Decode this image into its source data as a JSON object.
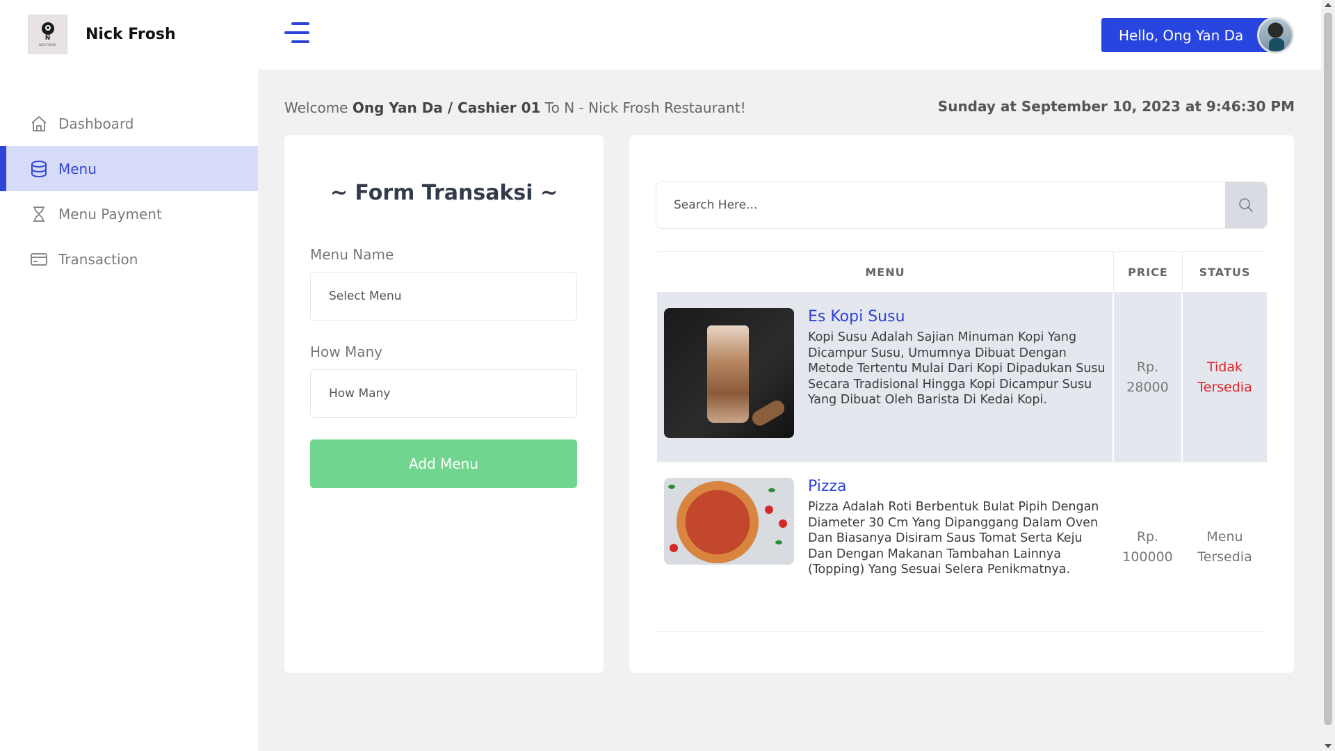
{
  "brand": {
    "name": "Nick Frosh",
    "logo_letter": "N",
    "logo_tagline": "NICK FROSH"
  },
  "sidebar": {
    "items": [
      {
        "label": "Dashboard",
        "icon": "home-icon",
        "active": false
      },
      {
        "label": "Menu",
        "icon": "database-icon",
        "active": true
      },
      {
        "label": "Menu Payment",
        "icon": "hourglass-icon",
        "active": false
      },
      {
        "label": "Transaction",
        "icon": "credit-card-icon",
        "active": false
      }
    ]
  },
  "header": {
    "greeting": "Hello, Ong Yan Da",
    "menu_icon": "hamburger-menu-icon"
  },
  "welcome": {
    "prefix": "Welcome",
    "user": "Ong Yan Da / Cashier 01",
    "suffix": "To N - Nick Frosh Restaurant!",
    "datetime": "Sunday at September 10, 2023 at 9:46:30 PM"
  },
  "form": {
    "title": "~ Form Transaksi ~",
    "menu_name_label": "Menu Name",
    "menu_name_placeholder": "Select Menu",
    "how_many_label": "How Many",
    "how_many_placeholder": "How Many",
    "submit_label": "Add Menu"
  },
  "search": {
    "placeholder": "Search Here...",
    "icon": "search-icon"
  },
  "table": {
    "headers": {
      "menu": "MENU",
      "price": "PRICE",
      "status": "STATUS"
    },
    "rows": [
      {
        "name": "Es Kopi Susu",
        "description": "Kopi Susu Adalah Sajian Minuman Kopi Yang Dicampur Susu, Umumnya Dibuat Dengan Metode Tertentu Mulai Dari Kopi Dipadukan Susu Secara Tradisional Hingga Kopi Dicampur Susu Yang Dibuat Oleh Barista Di Kedai Kopi.",
        "price_prefix": "Rp.",
        "price_value": "28000",
        "status_line1": "Tidak",
        "status_line2": "Tersedia"
      },
      {
        "name": "Pizza",
        "description": "Pizza Adalah Roti Berbentuk Bulat Pipih Dengan Diameter 30 Cm Yang Dipanggang Dalam Oven Dan Biasanya Disiram Saus Tomat Serta Keju Dan Dengan Makanan Tambahan Lainnya (Topping) Yang Sesuai Selera Penikmatnya.",
        "price_prefix": "Rp.",
        "price_value": "100000",
        "status_line1": "Menu",
        "status_line2": "Tersedia"
      }
    ]
  },
  "colors": {
    "accent": "#2e43d8",
    "add_button": "#72d58f",
    "status_unavailable": "#e02424"
  }
}
